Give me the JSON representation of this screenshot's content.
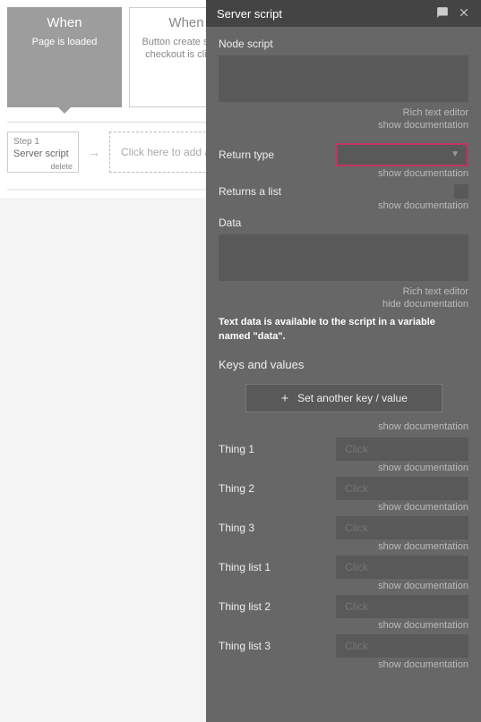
{
  "workflow": {
    "events": [
      {
        "title": "When",
        "subtitle": "Page is loaded",
        "active": true
      },
      {
        "title": "When",
        "subtitle": "Button create stripe-checkout is clicked",
        "active": false
      }
    ],
    "step": {
      "step_label": "Step 1",
      "title": "Server script",
      "delete_label": "delete"
    },
    "add_label": "Click here to add an action..."
  },
  "panel": {
    "title": "Server script",
    "node_script_label": "Node script",
    "rich_text": "Rich text editor",
    "show_doc": "show documentation",
    "hide_doc": "hide documentation",
    "return_type_label": "Return type",
    "returns_list_label": "Returns a list",
    "data_label": "Data",
    "data_hint": "Text data is available to the script in a variable named \"data\".",
    "keys_values_label": "Keys and values",
    "add_kv_label": "Set another key / value",
    "things": [
      {
        "label": "Thing 1",
        "placeholder": "Click"
      },
      {
        "label": "Thing 2",
        "placeholder": "Click"
      },
      {
        "label": "Thing 3",
        "placeholder": "Click"
      },
      {
        "label": "Thing list 1",
        "placeholder": "Click"
      },
      {
        "label": "Thing list 2",
        "placeholder": "Click"
      },
      {
        "label": "Thing list 3",
        "placeholder": "Click"
      }
    ]
  }
}
